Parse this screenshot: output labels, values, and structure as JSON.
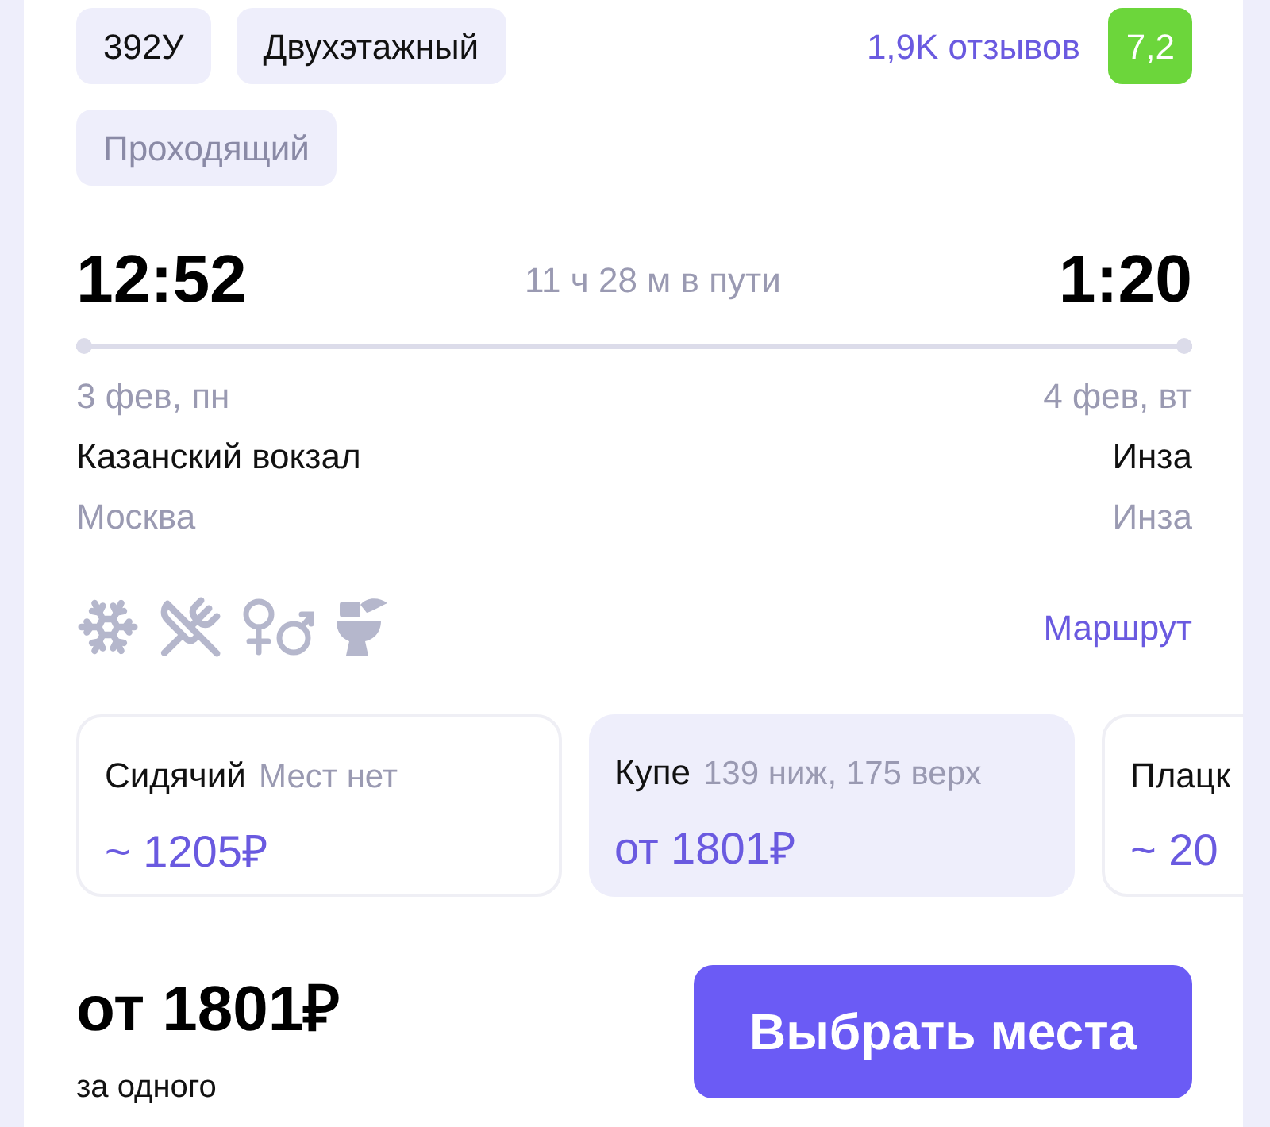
{
  "tags": [
    {
      "label": "392У",
      "muted": false
    },
    {
      "label": "Двухэтажный",
      "muted": false
    },
    {
      "label": "Проходящий",
      "muted": true
    }
  ],
  "reviews": {
    "count": "1,9K отзывов",
    "rating": "7,2"
  },
  "departure": {
    "time": "12:52",
    "date": "3 фев, пн",
    "station": "Казанский вокзал",
    "city": "Москва"
  },
  "duration": "11 ч 28 м в пути",
  "arrival": {
    "time": "1:20",
    "date": "4 фев, вт",
    "station": "Инза",
    "city": "Инза"
  },
  "amenities": [
    {
      "kind": "climate"
    },
    {
      "kind": "food"
    },
    {
      "kind": "gender"
    },
    {
      "kind": "toilet"
    }
  ],
  "route_link": "Маршрут",
  "classes": [
    {
      "name": "Сидячий",
      "seats": "Мест нет",
      "price": "~ 1205₽",
      "selected": false
    },
    {
      "name": "Купе",
      "seats": "139 ниж, 175 верх",
      "price": "от 1801₽",
      "selected": true
    },
    {
      "name": "Плацк",
      "price": "~ 20",
      "selected": false
    }
  ],
  "total": {
    "price": "от 1801₽",
    "note": "за одного"
  },
  "select_button": "Выбрать места"
}
